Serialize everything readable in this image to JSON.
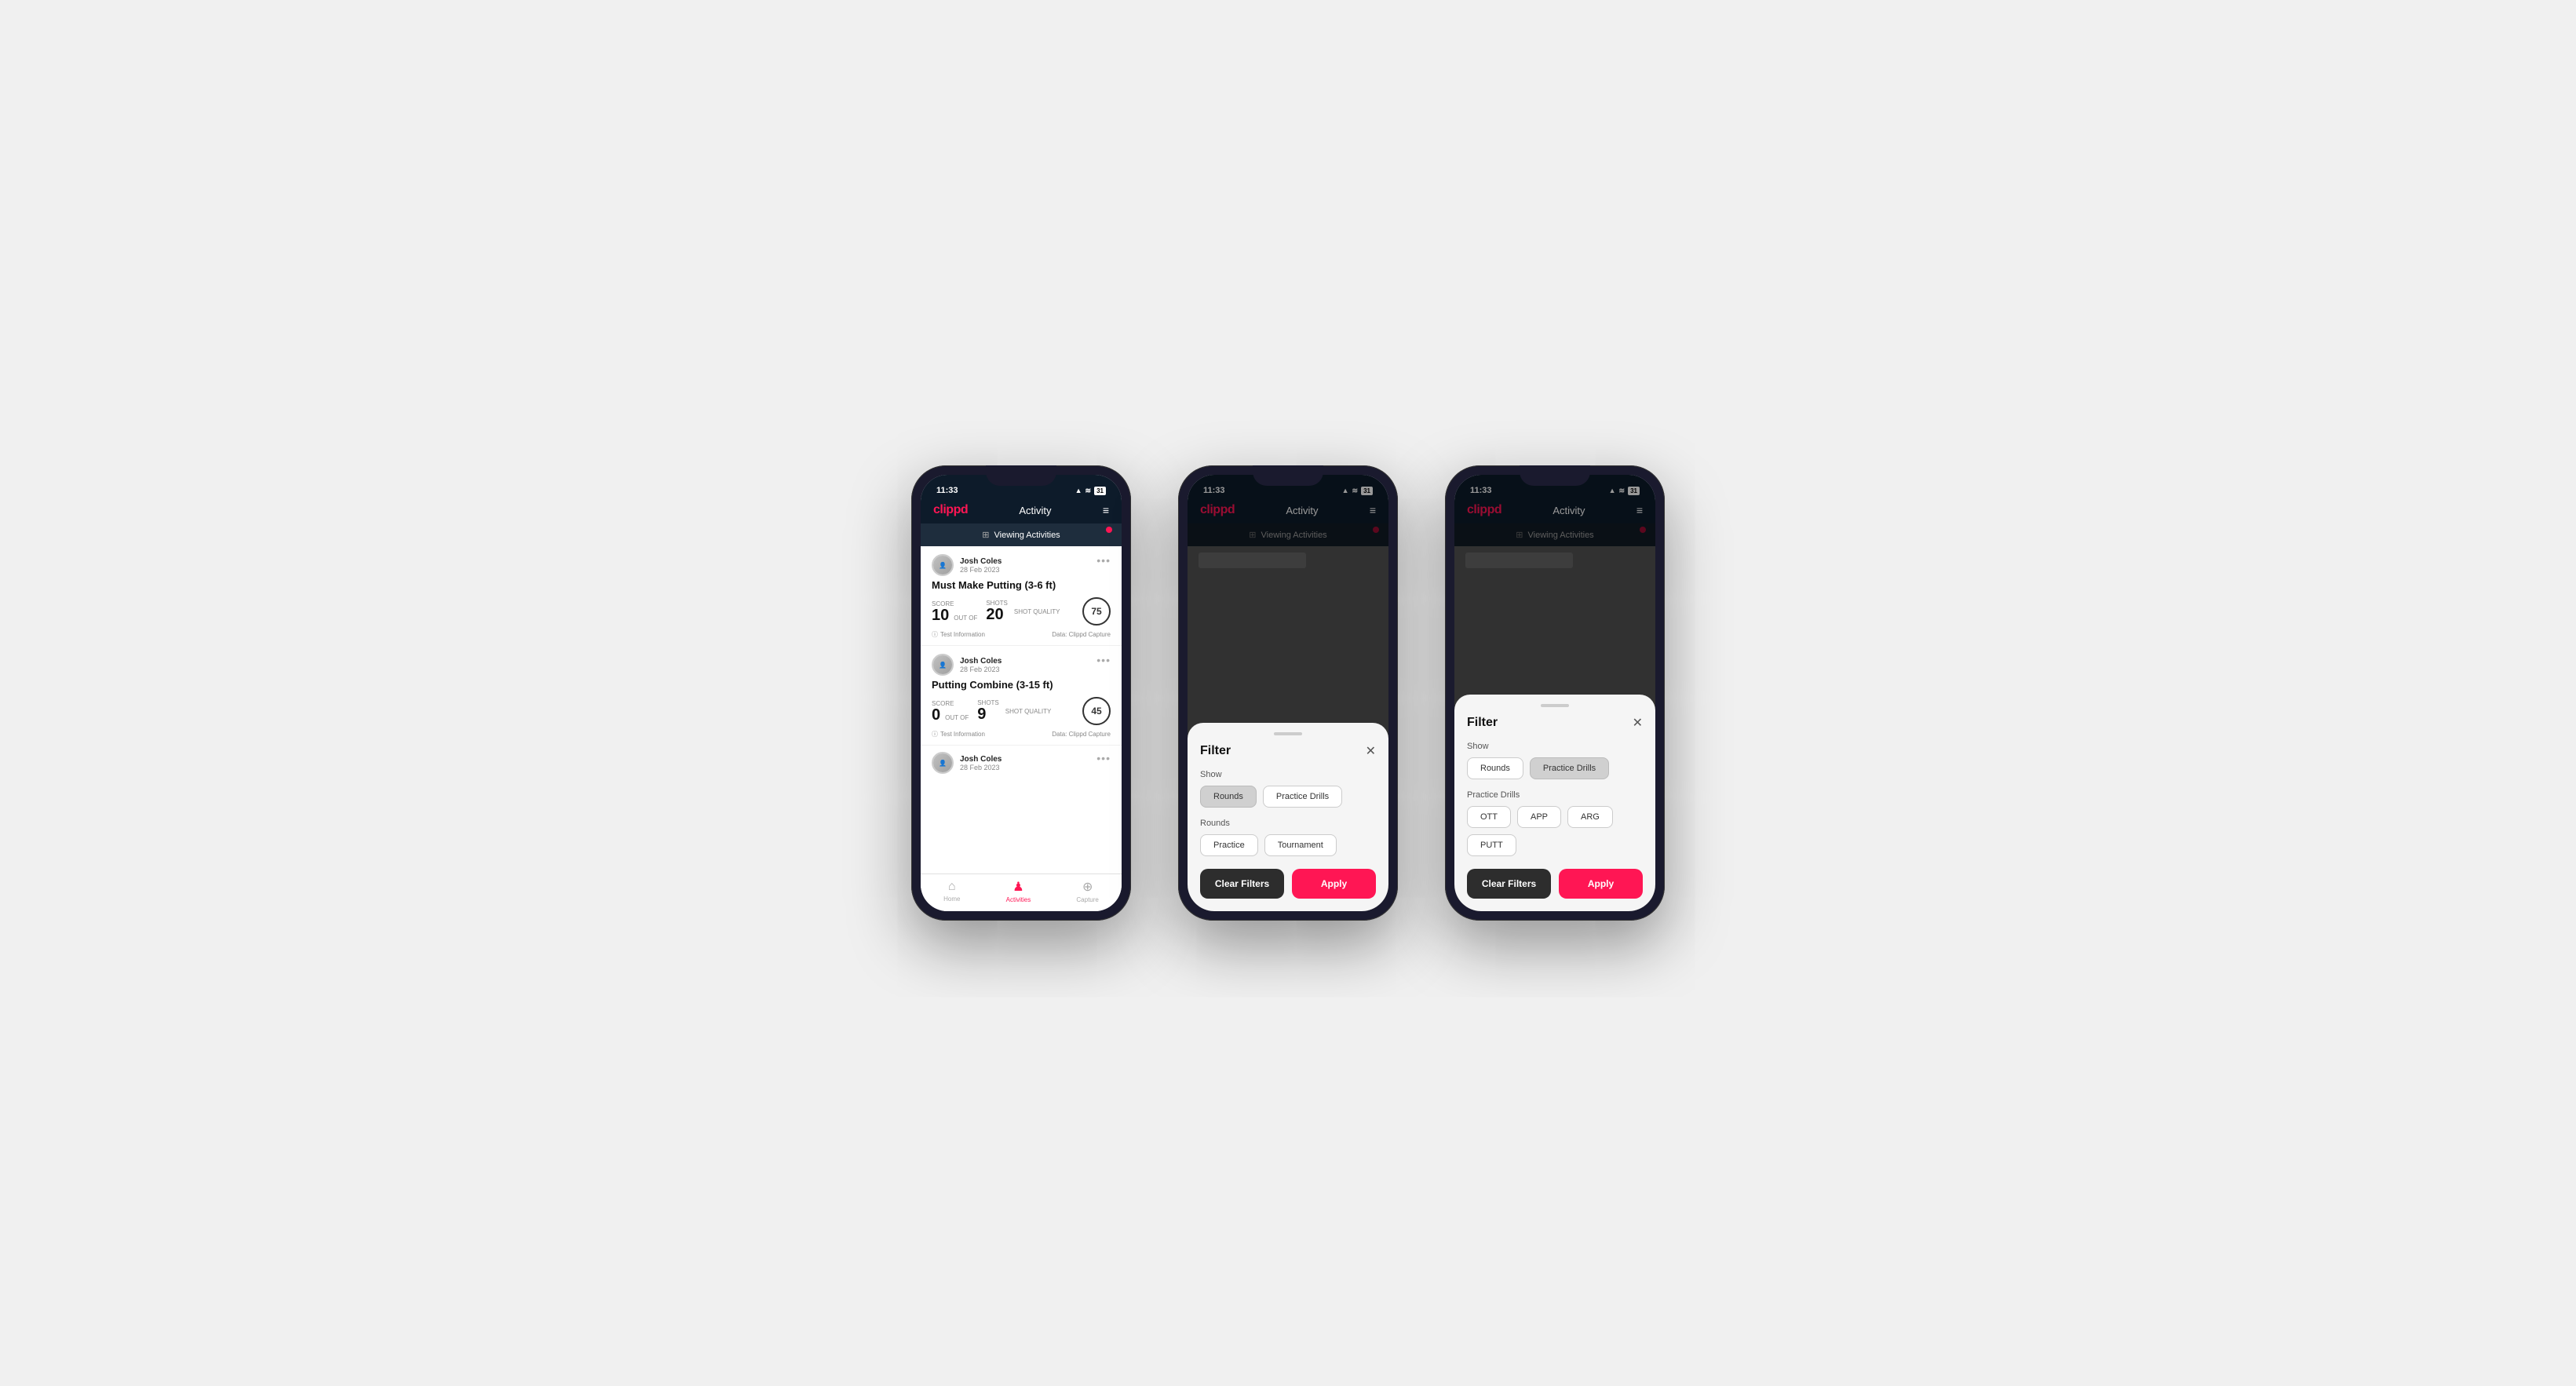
{
  "phone1": {
    "status": {
      "time": "11:33",
      "icons": "▲ ≋ ⬛"
    },
    "header": {
      "logo": "clippd",
      "title": "Activity",
      "menu": "≡"
    },
    "viewingBar": {
      "icon": "⊞",
      "text": "Viewing Activities"
    },
    "cards": [
      {
        "userName": "Josh Coles",
        "userDate": "28 Feb 2023",
        "title": "Must Make Putting (3-6 ft)",
        "scoreLabel": "Score",
        "scoreValue": "10",
        "shotsLabel": "Shots",
        "shotsValue": "20",
        "qualityLabel": "Shot Quality",
        "qualityValue": "75",
        "footerInfo": "Test Information",
        "footerData": "Data: Clippd Capture"
      },
      {
        "userName": "Josh Coles",
        "userDate": "28 Feb 2023",
        "title": "Putting Combine (3-15 ft)",
        "scoreLabel": "Score",
        "scoreValue": "0",
        "shotsLabel": "Shots",
        "shotsValue": "9",
        "qualityLabel": "Shot Quality",
        "qualityValue": "45",
        "footerInfo": "Test Information",
        "footerData": "Data: Clippd Capture"
      },
      {
        "userName": "Josh Coles",
        "userDate": "28 Feb 2023",
        "title": "",
        "scoreLabel": "",
        "scoreValue": "",
        "shotsLabel": "",
        "shotsValue": "",
        "qualityLabel": "",
        "qualityValue": "",
        "footerInfo": "",
        "footerData": ""
      }
    ],
    "nav": {
      "home": "Home",
      "activities": "Activities",
      "capture": "Capture"
    }
  },
  "phone2": {
    "status": {
      "time": "11:33"
    },
    "header": {
      "logo": "clippd",
      "title": "Activity"
    },
    "viewingBar": {
      "text": "Viewing Activities"
    },
    "modal": {
      "title": "Filter",
      "showLabel": "Show",
      "showButtons": [
        "Rounds",
        "Practice Drills"
      ],
      "activeShowBtn": "Rounds",
      "roundsLabel": "Rounds",
      "roundButtons": [
        "Practice",
        "Tournament"
      ],
      "clearFilters": "Clear Filters",
      "apply": "Apply"
    }
  },
  "phone3": {
    "status": {
      "time": "11:33"
    },
    "header": {
      "logo": "clippd",
      "title": "Activity"
    },
    "viewingBar": {
      "text": "Viewing Activities"
    },
    "modal": {
      "title": "Filter",
      "showLabel": "Show",
      "showButtons": [
        "Rounds",
        "Practice Drills"
      ],
      "activeShowBtn": "Practice Drills",
      "drillsLabel": "Practice Drills",
      "drillButtons": [
        "OTT",
        "APP",
        "ARG",
        "PUTT"
      ],
      "clearFilters": "Clear Filters",
      "apply": "Apply"
    }
  }
}
